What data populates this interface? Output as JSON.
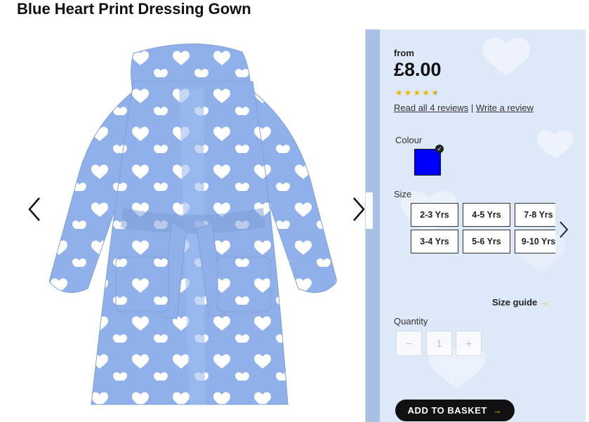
{
  "product": {
    "title": "Blue Heart Print Dressing Gown"
  },
  "gallery": {
    "prev_icon": "chevron-left-icon",
    "next_icon": "chevron-right-icon",
    "robe_color": "#8fb0ea"
  },
  "panel": {
    "from_label": "from",
    "price": "£8.00",
    "rating": {
      "stars": 4.5,
      "max": 5,
      "star_color": "#f2b700"
    },
    "reviews_link": "Read all 4 reviews",
    "separator": "|",
    "write_review_link": "Write a review",
    "colour_label": "Colour",
    "colour_swatch": "#0000ff",
    "size_label": "Size",
    "sizes": [
      "2-3 Yrs",
      "4-5 Yrs",
      "7-8 Yrs",
      "3-4 Yrs",
      "5-6 Yrs",
      "9-10 Yrs"
    ],
    "size_guide": "Size guide",
    "size_guide_arrow": "→",
    "quantity_label": "Quantity",
    "quantity": {
      "minus": "−",
      "value": "1",
      "plus": "+"
    },
    "add_to_basket": "ADD TO BASKET",
    "add_to_basket_arrow": "→"
  }
}
